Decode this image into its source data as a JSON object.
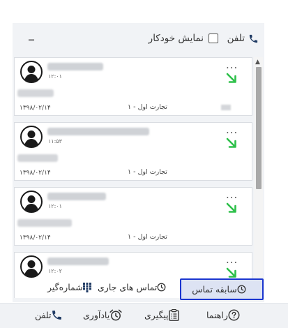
{
  "header": {
    "phone_label": "تلفن",
    "auto_show_label": "نمایش خودکار",
    "collapse_symbol": "–"
  },
  "calls": [
    {
      "time": "۱۲:۰۱",
      "queue": "تجارت اول - ۱",
      "date": "۱۳۹۸/۰۲/۱۴",
      "menu": "..."
    },
    {
      "time": "۱۱:۵۳",
      "queue": "تجارت اول - ۱",
      "date": "۱۳۹۸/۰۲/۱۴",
      "menu": "..."
    },
    {
      "time": "۱۲:۰۱",
      "queue": "تجارت اول - ۱",
      "date": "۱۳۹۸/۰۲/۱۴",
      "menu": "..."
    },
    {
      "time": "۱۲:۰۲",
      "menu": "..."
    }
  ],
  "call_direction_color": "#2ec04a",
  "active_tab_border_color": "#1b36d0",
  "subtabs": {
    "history": "سابقه تماس",
    "current": "تماس های جاری",
    "dialer": "شماره‌گیر"
  },
  "bottom_nav": {
    "phone": "تلفن",
    "reminder": "یادآوری",
    "followup": "پیگیری",
    "guide": "راهنما"
  },
  "icons": {
    "phone": "phone-icon",
    "incoming_call": "arrow-down-right-icon",
    "avatar": "user-avatar-icon",
    "clock": "clock-icon",
    "keypad": "keypad-icon",
    "alarm": "alarm-clock-icon",
    "clipboard": "clipboard-icon",
    "help": "question-circle-icon"
  }
}
